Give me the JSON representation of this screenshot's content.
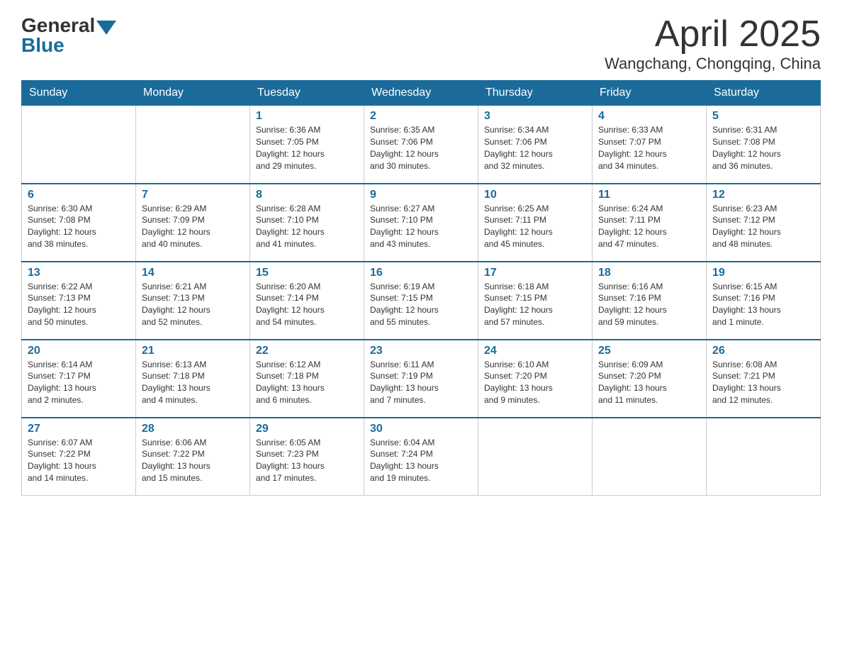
{
  "header": {
    "logo_general": "General",
    "logo_blue": "Blue",
    "month_title": "April 2025",
    "location": "Wangchang, Chongqing, China"
  },
  "days_of_week": [
    "Sunday",
    "Monday",
    "Tuesday",
    "Wednesday",
    "Thursday",
    "Friday",
    "Saturday"
  ],
  "weeks": [
    [
      {
        "day": "",
        "info": ""
      },
      {
        "day": "",
        "info": ""
      },
      {
        "day": "1",
        "info": "Sunrise: 6:36 AM\nSunset: 7:05 PM\nDaylight: 12 hours\nand 29 minutes."
      },
      {
        "day": "2",
        "info": "Sunrise: 6:35 AM\nSunset: 7:06 PM\nDaylight: 12 hours\nand 30 minutes."
      },
      {
        "day": "3",
        "info": "Sunrise: 6:34 AM\nSunset: 7:06 PM\nDaylight: 12 hours\nand 32 minutes."
      },
      {
        "day": "4",
        "info": "Sunrise: 6:33 AM\nSunset: 7:07 PM\nDaylight: 12 hours\nand 34 minutes."
      },
      {
        "day": "5",
        "info": "Sunrise: 6:31 AM\nSunset: 7:08 PM\nDaylight: 12 hours\nand 36 minutes."
      }
    ],
    [
      {
        "day": "6",
        "info": "Sunrise: 6:30 AM\nSunset: 7:08 PM\nDaylight: 12 hours\nand 38 minutes."
      },
      {
        "day": "7",
        "info": "Sunrise: 6:29 AM\nSunset: 7:09 PM\nDaylight: 12 hours\nand 40 minutes."
      },
      {
        "day": "8",
        "info": "Sunrise: 6:28 AM\nSunset: 7:10 PM\nDaylight: 12 hours\nand 41 minutes."
      },
      {
        "day": "9",
        "info": "Sunrise: 6:27 AM\nSunset: 7:10 PM\nDaylight: 12 hours\nand 43 minutes."
      },
      {
        "day": "10",
        "info": "Sunrise: 6:25 AM\nSunset: 7:11 PM\nDaylight: 12 hours\nand 45 minutes."
      },
      {
        "day": "11",
        "info": "Sunrise: 6:24 AM\nSunset: 7:11 PM\nDaylight: 12 hours\nand 47 minutes."
      },
      {
        "day": "12",
        "info": "Sunrise: 6:23 AM\nSunset: 7:12 PM\nDaylight: 12 hours\nand 48 minutes."
      }
    ],
    [
      {
        "day": "13",
        "info": "Sunrise: 6:22 AM\nSunset: 7:13 PM\nDaylight: 12 hours\nand 50 minutes."
      },
      {
        "day": "14",
        "info": "Sunrise: 6:21 AM\nSunset: 7:13 PM\nDaylight: 12 hours\nand 52 minutes."
      },
      {
        "day": "15",
        "info": "Sunrise: 6:20 AM\nSunset: 7:14 PM\nDaylight: 12 hours\nand 54 minutes."
      },
      {
        "day": "16",
        "info": "Sunrise: 6:19 AM\nSunset: 7:15 PM\nDaylight: 12 hours\nand 55 minutes."
      },
      {
        "day": "17",
        "info": "Sunrise: 6:18 AM\nSunset: 7:15 PM\nDaylight: 12 hours\nand 57 minutes."
      },
      {
        "day": "18",
        "info": "Sunrise: 6:16 AM\nSunset: 7:16 PM\nDaylight: 12 hours\nand 59 minutes."
      },
      {
        "day": "19",
        "info": "Sunrise: 6:15 AM\nSunset: 7:16 PM\nDaylight: 13 hours\nand 1 minute."
      }
    ],
    [
      {
        "day": "20",
        "info": "Sunrise: 6:14 AM\nSunset: 7:17 PM\nDaylight: 13 hours\nand 2 minutes."
      },
      {
        "day": "21",
        "info": "Sunrise: 6:13 AM\nSunset: 7:18 PM\nDaylight: 13 hours\nand 4 minutes."
      },
      {
        "day": "22",
        "info": "Sunrise: 6:12 AM\nSunset: 7:18 PM\nDaylight: 13 hours\nand 6 minutes."
      },
      {
        "day": "23",
        "info": "Sunrise: 6:11 AM\nSunset: 7:19 PM\nDaylight: 13 hours\nand 7 minutes."
      },
      {
        "day": "24",
        "info": "Sunrise: 6:10 AM\nSunset: 7:20 PM\nDaylight: 13 hours\nand 9 minutes."
      },
      {
        "day": "25",
        "info": "Sunrise: 6:09 AM\nSunset: 7:20 PM\nDaylight: 13 hours\nand 11 minutes."
      },
      {
        "day": "26",
        "info": "Sunrise: 6:08 AM\nSunset: 7:21 PM\nDaylight: 13 hours\nand 12 minutes."
      }
    ],
    [
      {
        "day": "27",
        "info": "Sunrise: 6:07 AM\nSunset: 7:22 PM\nDaylight: 13 hours\nand 14 minutes."
      },
      {
        "day": "28",
        "info": "Sunrise: 6:06 AM\nSunset: 7:22 PM\nDaylight: 13 hours\nand 15 minutes."
      },
      {
        "day": "29",
        "info": "Sunrise: 6:05 AM\nSunset: 7:23 PM\nDaylight: 13 hours\nand 17 minutes."
      },
      {
        "day": "30",
        "info": "Sunrise: 6:04 AM\nSunset: 7:24 PM\nDaylight: 13 hours\nand 19 minutes."
      },
      {
        "day": "",
        "info": ""
      },
      {
        "day": "",
        "info": ""
      },
      {
        "day": "",
        "info": ""
      }
    ]
  ]
}
